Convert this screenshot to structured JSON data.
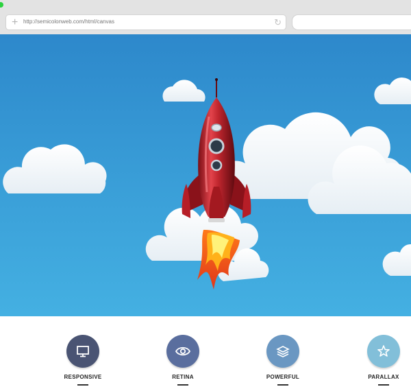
{
  "browser": {
    "url": "http://semicolonweb.com/html/canvas",
    "search_placeholder": ""
  },
  "hero": {
    "sky_top": "#2d88cb",
    "sky_bottom": "#44b0e2",
    "rocket_color": "#c0262e"
  },
  "features": [
    {
      "label": "RESPONSIVE",
      "icon": "monitor-icon",
      "color": "#4a5473"
    },
    {
      "label": "RETINA",
      "icon": "eye-icon",
      "color": "#5a6e9e"
    },
    {
      "label": "POWERFUL",
      "icon": "layers-icon",
      "color": "#6a97c2"
    },
    {
      "label": "PARALLAX",
      "icon": "star-icon",
      "color": "#82bfd9"
    }
  ]
}
